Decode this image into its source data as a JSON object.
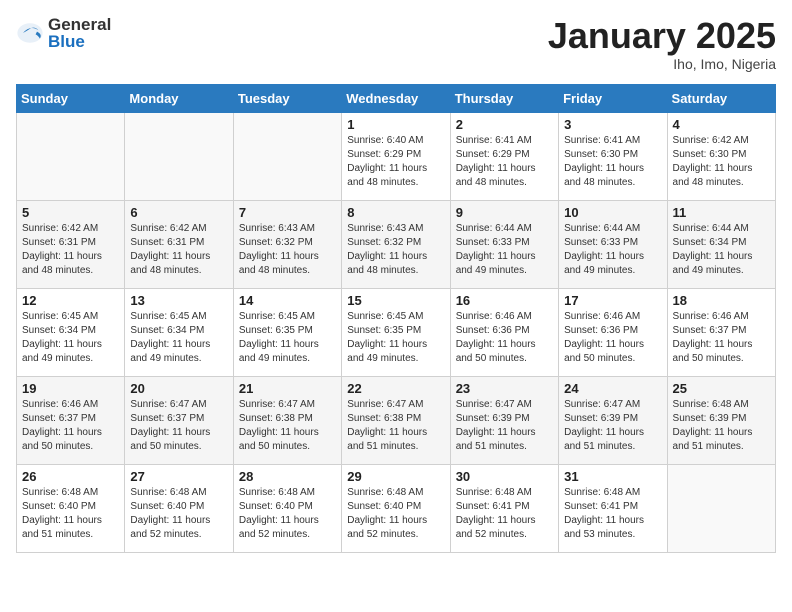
{
  "header": {
    "logo_general": "General",
    "logo_blue": "Blue",
    "month": "January 2025",
    "location": "Iho, Imo, Nigeria"
  },
  "weekdays": [
    "Sunday",
    "Monday",
    "Tuesday",
    "Wednesday",
    "Thursday",
    "Friday",
    "Saturday"
  ],
  "weeks": [
    [
      {
        "day": "",
        "info": ""
      },
      {
        "day": "",
        "info": ""
      },
      {
        "day": "",
        "info": ""
      },
      {
        "day": "1",
        "info": "Sunrise: 6:40 AM\nSunset: 6:29 PM\nDaylight: 11 hours and 48 minutes."
      },
      {
        "day": "2",
        "info": "Sunrise: 6:41 AM\nSunset: 6:29 PM\nDaylight: 11 hours and 48 minutes."
      },
      {
        "day": "3",
        "info": "Sunrise: 6:41 AM\nSunset: 6:30 PM\nDaylight: 11 hours and 48 minutes."
      },
      {
        "day": "4",
        "info": "Sunrise: 6:42 AM\nSunset: 6:30 PM\nDaylight: 11 hours and 48 minutes."
      }
    ],
    [
      {
        "day": "5",
        "info": "Sunrise: 6:42 AM\nSunset: 6:31 PM\nDaylight: 11 hours and 48 minutes."
      },
      {
        "day": "6",
        "info": "Sunrise: 6:42 AM\nSunset: 6:31 PM\nDaylight: 11 hours and 48 minutes."
      },
      {
        "day": "7",
        "info": "Sunrise: 6:43 AM\nSunset: 6:32 PM\nDaylight: 11 hours and 48 minutes."
      },
      {
        "day": "8",
        "info": "Sunrise: 6:43 AM\nSunset: 6:32 PM\nDaylight: 11 hours and 48 minutes."
      },
      {
        "day": "9",
        "info": "Sunrise: 6:44 AM\nSunset: 6:33 PM\nDaylight: 11 hours and 49 minutes."
      },
      {
        "day": "10",
        "info": "Sunrise: 6:44 AM\nSunset: 6:33 PM\nDaylight: 11 hours and 49 minutes."
      },
      {
        "day": "11",
        "info": "Sunrise: 6:44 AM\nSunset: 6:34 PM\nDaylight: 11 hours and 49 minutes."
      }
    ],
    [
      {
        "day": "12",
        "info": "Sunrise: 6:45 AM\nSunset: 6:34 PM\nDaylight: 11 hours and 49 minutes."
      },
      {
        "day": "13",
        "info": "Sunrise: 6:45 AM\nSunset: 6:34 PM\nDaylight: 11 hours and 49 minutes."
      },
      {
        "day": "14",
        "info": "Sunrise: 6:45 AM\nSunset: 6:35 PM\nDaylight: 11 hours and 49 minutes."
      },
      {
        "day": "15",
        "info": "Sunrise: 6:45 AM\nSunset: 6:35 PM\nDaylight: 11 hours and 49 minutes."
      },
      {
        "day": "16",
        "info": "Sunrise: 6:46 AM\nSunset: 6:36 PM\nDaylight: 11 hours and 50 minutes."
      },
      {
        "day": "17",
        "info": "Sunrise: 6:46 AM\nSunset: 6:36 PM\nDaylight: 11 hours and 50 minutes."
      },
      {
        "day": "18",
        "info": "Sunrise: 6:46 AM\nSunset: 6:37 PM\nDaylight: 11 hours and 50 minutes."
      }
    ],
    [
      {
        "day": "19",
        "info": "Sunrise: 6:46 AM\nSunset: 6:37 PM\nDaylight: 11 hours and 50 minutes."
      },
      {
        "day": "20",
        "info": "Sunrise: 6:47 AM\nSunset: 6:37 PM\nDaylight: 11 hours and 50 minutes."
      },
      {
        "day": "21",
        "info": "Sunrise: 6:47 AM\nSunset: 6:38 PM\nDaylight: 11 hours and 50 minutes."
      },
      {
        "day": "22",
        "info": "Sunrise: 6:47 AM\nSunset: 6:38 PM\nDaylight: 11 hours and 51 minutes."
      },
      {
        "day": "23",
        "info": "Sunrise: 6:47 AM\nSunset: 6:39 PM\nDaylight: 11 hours and 51 minutes."
      },
      {
        "day": "24",
        "info": "Sunrise: 6:47 AM\nSunset: 6:39 PM\nDaylight: 11 hours and 51 minutes."
      },
      {
        "day": "25",
        "info": "Sunrise: 6:48 AM\nSunset: 6:39 PM\nDaylight: 11 hours and 51 minutes."
      }
    ],
    [
      {
        "day": "26",
        "info": "Sunrise: 6:48 AM\nSunset: 6:40 PM\nDaylight: 11 hours and 51 minutes."
      },
      {
        "day": "27",
        "info": "Sunrise: 6:48 AM\nSunset: 6:40 PM\nDaylight: 11 hours and 52 minutes."
      },
      {
        "day": "28",
        "info": "Sunrise: 6:48 AM\nSunset: 6:40 PM\nDaylight: 11 hours and 52 minutes."
      },
      {
        "day": "29",
        "info": "Sunrise: 6:48 AM\nSunset: 6:40 PM\nDaylight: 11 hours and 52 minutes."
      },
      {
        "day": "30",
        "info": "Sunrise: 6:48 AM\nSunset: 6:41 PM\nDaylight: 11 hours and 52 minutes."
      },
      {
        "day": "31",
        "info": "Sunrise: 6:48 AM\nSunset: 6:41 PM\nDaylight: 11 hours and 53 minutes."
      },
      {
        "day": "",
        "info": ""
      }
    ]
  ]
}
